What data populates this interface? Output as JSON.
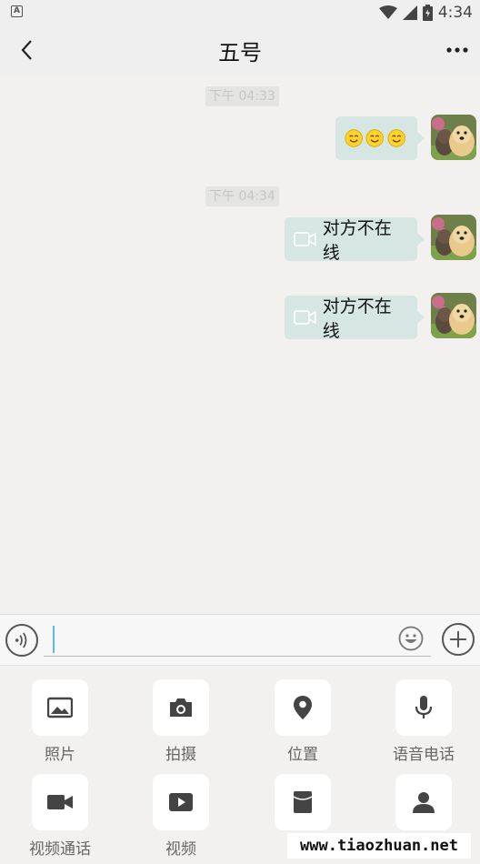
{
  "status_bar": {
    "notification_badge": "A",
    "time": "4:34"
  },
  "header": {
    "title": "五号"
  },
  "messages": [
    {
      "type": "time",
      "text": "下午 04:33"
    },
    {
      "type": "emoji",
      "from": "me",
      "emojis": [
        "smiling-face-icon",
        "smiling-face-icon",
        "smiling-face-icon"
      ]
    },
    {
      "type": "time",
      "text": "下午 04:34"
    },
    {
      "type": "video-call",
      "from": "me",
      "text": "对方不在线"
    },
    {
      "type": "video-call",
      "from": "me",
      "text": "对方不在线"
    }
  ],
  "input": {
    "value": "",
    "placeholder": ""
  },
  "tools": [
    {
      "label": "照片",
      "icon": "image-icon"
    },
    {
      "label": "拍摄",
      "icon": "camera-icon"
    },
    {
      "label": "位置",
      "icon": "location-pin-icon"
    },
    {
      "label": "语音电话",
      "icon": "microphone-icon"
    },
    {
      "label": "视频通话",
      "icon": "video-camera-icon"
    },
    {
      "label": "视频",
      "icon": "video-play-icon"
    },
    {
      "label": "",
      "icon": "red-packet-icon"
    },
    {
      "label": "",
      "icon": "contact-card-icon"
    }
  ],
  "watermark": "www.tiaozhuan.net",
  "colors": {
    "bubble": "#d5e6e3",
    "background": "#f2f1ef",
    "caret": "#5fb8e8"
  }
}
